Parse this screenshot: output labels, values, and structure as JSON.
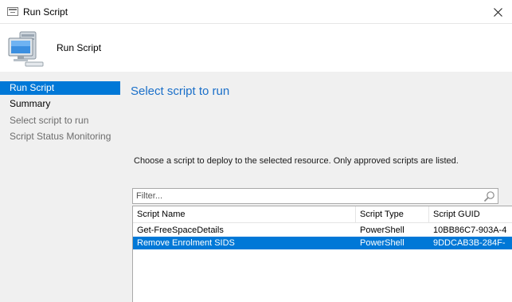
{
  "window": {
    "title": "Run Script",
    "app_icon": "window-icon",
    "close_icon": "close-icon"
  },
  "header": {
    "title": "Run Script",
    "icon": "computer-icon"
  },
  "sidebar": {
    "items": [
      {
        "label": "Run Script",
        "state": "active"
      },
      {
        "label": "Summary",
        "state": "normal"
      },
      {
        "label": "Select script to run",
        "state": "dim"
      },
      {
        "label": "Script Status Monitoring",
        "state": "dim"
      }
    ]
  },
  "main": {
    "heading": "Select script to run",
    "description": "Choose a script to deploy to the selected resource. Only approved scripts are listed.",
    "filter": {
      "placeholder": "Filter...",
      "value": "",
      "icon": "search-icon"
    },
    "table": {
      "columns": [
        "Script Name",
        "Script Type",
        "Script GUID"
      ],
      "rows": [
        {
          "name": "Get-FreeSpaceDetails",
          "type": "PowerShell",
          "guid": "10BB86C7-903A-4",
          "selected": false
        },
        {
          "name": "Remove Enrolment SIDS",
          "type": "PowerShell",
          "guid": "9DDCAB3B-284F-",
          "selected": true
        }
      ]
    }
  },
  "colors": {
    "accent": "#0078d7",
    "heading": "#1a6fc9",
    "panel": "#f0f0f0"
  }
}
